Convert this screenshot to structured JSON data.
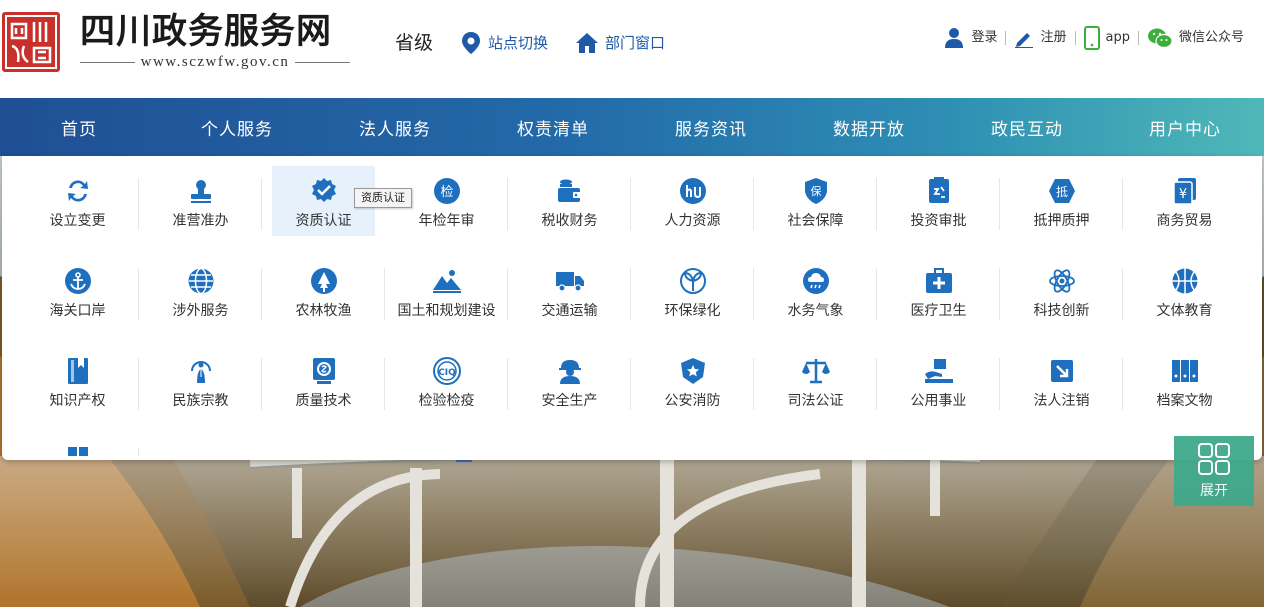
{
  "header": {
    "seal_text": "四川",
    "title": "四川政务服务网",
    "url": "www.sczwfw.gov.cn",
    "level": "省级",
    "site_switch": "站点切换",
    "dept_window": "部门窗口",
    "login": "登录",
    "register": "注册",
    "app": "app",
    "wechat": "微信公众号"
  },
  "nav": [
    "首页",
    "个人服务",
    "法人服务",
    "权责清单",
    "服务资讯",
    "数据开放",
    "政民互动",
    "用户中心"
  ],
  "categories": [
    {
      "label": "设立变更",
      "icon": "exchange-icon"
    },
    {
      "label": "准营准办",
      "icon": "stamp-icon"
    },
    {
      "label": "资质认证",
      "icon": "certified-badge-icon"
    },
    {
      "label": "年检年审",
      "icon": "inspection-icon"
    },
    {
      "label": "税收财务",
      "icon": "wallet-icon"
    },
    {
      "label": "人力资源",
      "icon": "hr-icon"
    },
    {
      "label": "社会保障",
      "icon": "shield-icon"
    },
    {
      "label": "投资审批",
      "icon": "approval-doc-icon"
    },
    {
      "label": "抵押质押",
      "icon": "mortgage-icon"
    },
    {
      "label": "商务贸易",
      "icon": "yuan-doc-icon"
    },
    {
      "label": "海关口岸",
      "icon": "anchor-icon"
    },
    {
      "label": "涉外服务",
      "icon": "globe-icon"
    },
    {
      "label": "农林牧渔",
      "icon": "tree-icon"
    },
    {
      "label": "国土和规划建设",
      "icon": "mountain-icon"
    },
    {
      "label": "交通运输",
      "icon": "truck-icon"
    },
    {
      "label": "环保绿化",
      "icon": "leaf-icon"
    },
    {
      "label": "水务气象",
      "icon": "cloud-rain-icon"
    },
    {
      "label": "医疗卫生",
      "icon": "medical-kit-icon"
    },
    {
      "label": "科技创新",
      "icon": "atom-icon"
    },
    {
      "label": "文体教育",
      "icon": "basketball-icon"
    },
    {
      "label": "知识产权",
      "icon": "book-icon"
    },
    {
      "label": "民族宗教",
      "icon": "prayer-icon"
    },
    {
      "label": "质量技术",
      "icon": "quality-seal-icon"
    },
    {
      "label": "检验检疫",
      "icon": "ciq-icon"
    },
    {
      "label": "安全生产",
      "icon": "helmet-worker-icon"
    },
    {
      "label": "公安消防",
      "icon": "police-badge-icon"
    },
    {
      "label": "司法公证",
      "icon": "scales-icon"
    },
    {
      "label": "公用事业",
      "icon": "public-box-icon"
    },
    {
      "label": "法人注销",
      "icon": "deregister-icon"
    },
    {
      "label": "档案文物",
      "icon": "archive-icon"
    },
    {
      "label": "",
      "icon": "grid-small-icon"
    }
  ],
  "tooltip": "资质认证",
  "expand_label": "展开",
  "colors": {
    "brand_blue": "#1e5aa8",
    "icon_blue": "#1f6fbf",
    "seal_red": "#c9302c",
    "expand_green": "#3fa98c"
  }
}
